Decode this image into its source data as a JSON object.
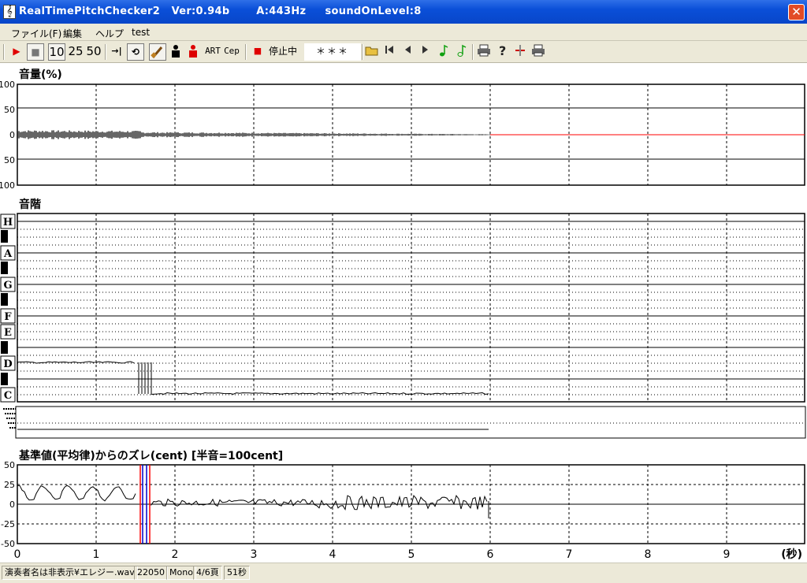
{
  "window": {
    "title": "RealTimePitchChecker2   Ver:0.94b       A:443Hz     soundOnLevel:8",
    "icon": "violin-icon",
    "close": "✕"
  },
  "menu": [
    "ファイル(F)",
    "編集",
    "ヘルプ",
    "test"
  ],
  "toolbar": {
    "play": "▶",
    "stop": "■",
    "zoom_options": [
      "10",
      "25",
      "50"
    ],
    "to_end": "→|",
    "loop": "⟲",
    "art_label": "ART",
    "cep_label": "Cep",
    "record_dot": "■",
    "state_label": "停止中",
    "note_display": "＊＊＊"
  },
  "volume_panel": {
    "label": "音量(%)",
    "y_ticks": [
      "100",
      "50",
      "0",
      "50",
      "100"
    ]
  },
  "scale_panel": {
    "label": "音階",
    "notes": [
      "H",
      "A",
      "G",
      "F",
      "E",
      "D",
      "C"
    ]
  },
  "deviation_panel": {
    "label": "基準値(平均律)からのズレ(cent) [半音=100cent]",
    "y_ticks": [
      "50",
      "25",
      "0",
      "-25",
      "-50"
    ]
  },
  "x_axis": {
    "ticks": [
      "0",
      "1",
      "2",
      "3",
      "4",
      "5",
      "6",
      "7",
      "8",
      "9"
    ],
    "unit": "(秒)"
  },
  "status": [
    "演奏者名は非表示¥エレジー.wav",
    "22050",
    "Mono",
    "4/6頁",
    "51秒"
  ],
  "colors": {
    "titlebar": "#0a4fd8",
    "waveform": "#000000",
    "silence_line": "#ff0000",
    "marker_red": "#ff0000",
    "marker_blue": "#0000cc"
  }
}
